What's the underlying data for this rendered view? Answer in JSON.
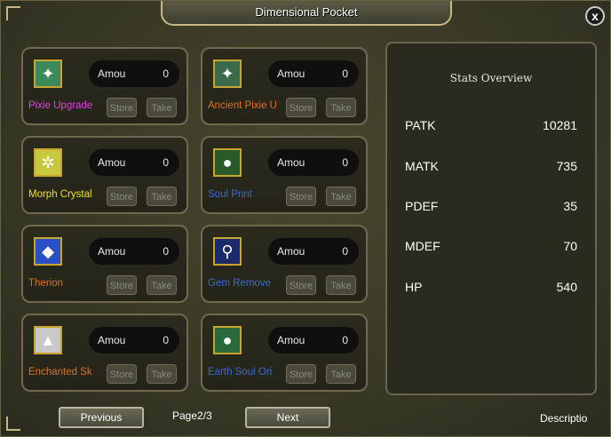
{
  "window": {
    "title": "Dimensional Pocket",
    "close_label": "x"
  },
  "items": [
    {
      "name": "Pixie Upgrade",
      "name_color": "#e040e0",
      "icon": "pixie-crystal-icon",
      "icon_bg": "#3a8a5a",
      "icon_glyph": "✦",
      "amount_label": "Amou",
      "amount": "0",
      "store_label": "Store",
      "take_label": "Take"
    },
    {
      "name": "Ancient Pixie U",
      "name_color": "#e07020",
      "icon": "ancient-pixie-icon",
      "icon_bg": "#3a6a4a",
      "icon_glyph": "✦",
      "amount_label": "Amou",
      "amount": "0",
      "store_label": "Store",
      "take_label": "Take"
    },
    {
      "name": "Morph Crystal",
      "name_color": "#f0e020",
      "icon": "morph-crystal-icon",
      "icon_bg": "#c8c840",
      "icon_glyph": "✲",
      "amount_label": "Amou",
      "amount": "0",
      "store_label": "Store",
      "take_label": "Take"
    },
    {
      "name": "Soul Print",
      "name_color": "#3a6ad8",
      "icon": "soul-print-icon",
      "icon_bg": "#2a5a2a",
      "icon_glyph": "●",
      "amount_label": "Amou",
      "amount": "0",
      "store_label": "Store",
      "take_label": "Take"
    },
    {
      "name": "Therion",
      "name_color": "#e07020",
      "icon": "therion-icon",
      "icon_bg": "#2a50c8",
      "icon_glyph": "◆",
      "amount_label": "Amou",
      "amount": "0",
      "store_label": "Store",
      "take_label": "Take"
    },
    {
      "name": "Gem Remove",
      "name_color": "#3a6ad8",
      "icon": "gem-remove-icon",
      "icon_bg": "#1a2a6a",
      "icon_glyph": "⚲",
      "amount_label": "Amou",
      "amount": "0",
      "store_label": "Store",
      "take_label": "Take"
    },
    {
      "name": "Enchanted Sk",
      "name_color": "#e07020",
      "icon": "enchanted-sk-icon",
      "icon_bg": "#c8c8c8",
      "icon_glyph": "▲",
      "amount_label": "Amou",
      "amount": "0",
      "store_label": "Store",
      "take_label": "Take"
    },
    {
      "name": "Earth Soul Ori",
      "name_color": "#3a6ad8",
      "icon": "earth-soul-orb-icon",
      "icon_bg": "#2a6a3a",
      "icon_glyph": "●",
      "amount_label": "Amou",
      "amount": "0",
      "store_label": "Store",
      "take_label": "Take"
    }
  ],
  "stats": {
    "title": "Stats Overview",
    "rows": [
      {
        "label": "PATK",
        "value": "10281"
      },
      {
        "label": "MATK",
        "value": "735"
      },
      {
        "label": "PDEF",
        "value": "35"
      },
      {
        "label": "MDEF",
        "value": "70"
      },
      {
        "label": "HP",
        "value": "540"
      }
    ]
  },
  "footer": {
    "previous_label": "Previous",
    "page_indicator": "Page2/3",
    "next_label": "Next",
    "description_label": "Descriptio"
  }
}
